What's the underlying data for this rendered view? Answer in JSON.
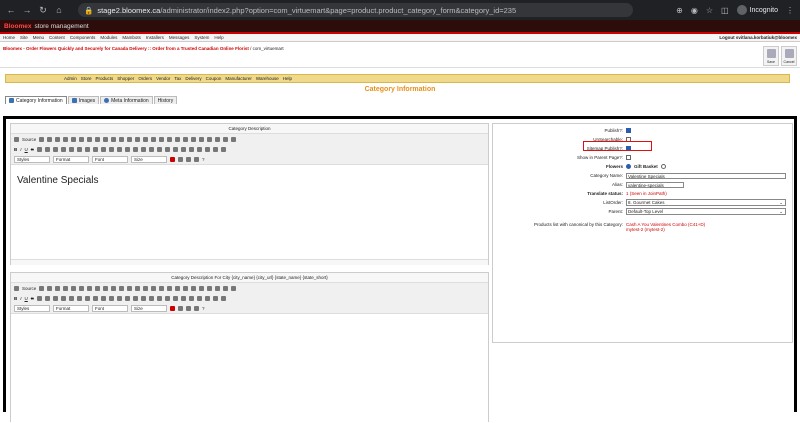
{
  "browser": {
    "url_host": "stage2.bloomex.ca",
    "url_path": "/administrator/index2.php?option=com_virtuemart&page=product.product_category_form&category_id=235",
    "profile": "Incognito"
  },
  "admin": {
    "brand": "Bloomex",
    "title": "store management",
    "menu": [
      "Home",
      "Site",
      "Menu",
      "Content",
      "Components",
      "Modules",
      "Mambots",
      "Installers",
      "Messages",
      "System",
      "Help"
    ],
    "logout": "Logout svitlana.korbatiuk@bloomex",
    "crumb_site": "Bloomex - Order Flowers Quickly and Securely for Canada Delivery :: Order from a Trusted Canadian Online Florist",
    "crumb_sep": " / com_virtuemart",
    "save_label": "Save",
    "cancel_label": "Cancel"
  },
  "vm_menu": [
    "Admin",
    "Store",
    "Products",
    "Shopper",
    "Orders",
    "Vendor",
    "Tax",
    "Delivery",
    "Coupon",
    "Manufacturer",
    "Warehouse",
    "Help"
  ],
  "page_title": "Category Information",
  "tabs": [
    "Category Information",
    "Images",
    "Meta Information",
    "History"
  ],
  "editor1": {
    "heading": "Category Description",
    "content": "Valentine Specials"
  },
  "editor2": {
    "heading": "Category Description For City {city_name} {city_url} {state_name} {state_short}"
  },
  "toolbar": {
    "source": "Source",
    "styles": "Styles",
    "format": "Format",
    "font": "Font",
    "size": "Size",
    "help": "?"
  },
  "form": {
    "publish_label": "Publish?:",
    "unsearchable_label": "UnSearchable:",
    "sitemap_label": "Sitemap Publish?:",
    "show_parent_label": "Show in Parent Page?:",
    "flowers_label": "Flowers",
    "gift_basket_label": "Gift Basket",
    "category_name_label": "Category Name:",
    "category_name_value": "Valentine Specials",
    "alias_label": "Alias:",
    "alias_value": "valentine-specials",
    "translate_label": "Translate status:",
    "translate_value": "1 (Seen in JoinPath)",
    "listorder_label": "ListOrder:",
    "listorder_value": "8. Gourmet Cakes",
    "parent_label": "Parent:",
    "parent_value": "Default-Top Level",
    "canonical_label": "Products list with canonical by this Category:",
    "canonical_value1": "Cash A You Valentines Combo (C41+D)",
    "canonical_value2": "mytest-2 (mytest-2)"
  }
}
